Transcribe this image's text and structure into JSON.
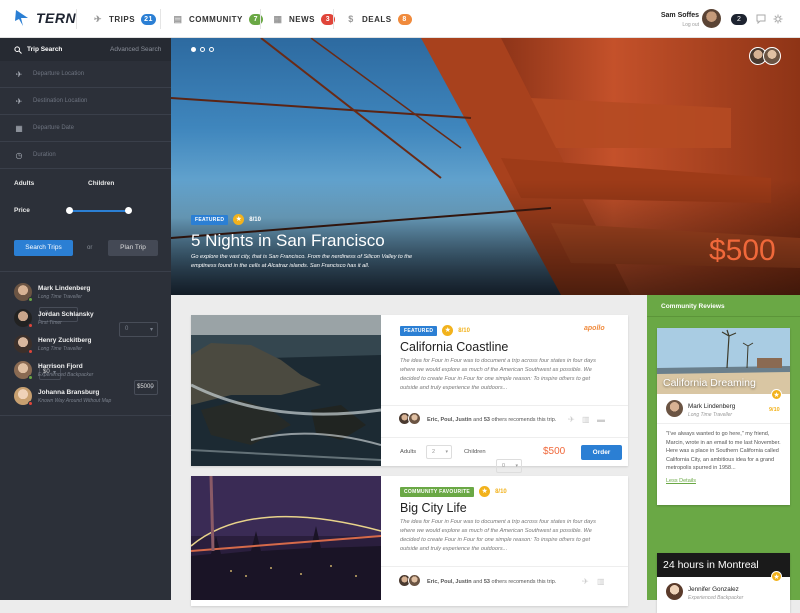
{
  "header": {
    "logo": "TERN",
    "nav": [
      {
        "label": "TRIPS",
        "badge": "21",
        "color": "#2b7fd4",
        "icon": "plane-icon"
      },
      {
        "label": "COMMUNITY",
        "badge": "7",
        "color": "#6aa845",
        "icon": "community-icon"
      },
      {
        "label": "NEWS",
        "badge": "3",
        "color": "#e0453a",
        "icon": "news-icon"
      },
      {
        "label": "DEALS",
        "badge": "8",
        "color": "#f08a3c",
        "icon": "deals-icon"
      }
    ],
    "user": {
      "name": "Sam Soffes",
      "logout": "Log out",
      "count": "2"
    }
  },
  "sidebar": {
    "tabs": {
      "active": "Trip Search",
      "inactive": "Advanced Search"
    },
    "fields": [
      {
        "placeholder": "Departure Location",
        "icon": "plane-takeoff-icon"
      },
      {
        "placeholder": "Destination Location",
        "icon": "plane-landing-icon"
      },
      {
        "placeholder": "Departure Date",
        "icon": "calendar-icon"
      },
      {
        "placeholder": "Duration",
        "icon": "clock-icon"
      }
    ],
    "adults_label": "Adults",
    "adults_value": "0",
    "children_label": "Children",
    "children_value": "0",
    "price_label": "Price",
    "price_min": "$0",
    "price_max": "$5000",
    "price_range": [
      0,
      1
    ],
    "search_button": "Search Trips",
    "or_text": "or",
    "plan_button": "Plan Trip",
    "people": [
      {
        "name": "Mark Lindenberg",
        "role": "Long Time Traveller",
        "status": "#6aa845"
      },
      {
        "name": "Jordan Schlansky",
        "role": "First Timer",
        "status": "#e0453a"
      },
      {
        "name": "Henry Zuckitberg",
        "role": "Long Time Traveller",
        "status": "#e0453a"
      },
      {
        "name": "Harrison Fjord",
        "role": "Experienced Backpacker",
        "status": "#6aa845"
      },
      {
        "name": "Johanna Bransburg",
        "role": "Known Way Around Without Map",
        "status": "#e0453a"
      }
    ]
  },
  "hero": {
    "tag": "FEATURED",
    "rating": "8/10",
    "title": "5 Nights in San Francisco",
    "description": "Go explore the vast city, that is San Francisco. From the nerdiness of Silicon Valley to the emptiness found in the cells at Alcatraz islands. San Francisco has it all.",
    "price": "$500"
  },
  "trips": [
    {
      "tag": "FEATURED",
      "tag_color": "#2b7fd4",
      "rating": "8/10",
      "brand": "apollo",
      "title": "California Coastline",
      "description": "The idea for Four in Four was to document a trip across four states in four days where we would explore as much of the American Southwest as possible. We decided to create Four in Four for one simple reason: To inspire others to get outside and truly experience the outdoors...",
      "recommend_names": "Eric, Poul, Justin",
      "recommend_and": "and",
      "recommend_count": "53",
      "recommend_rest": "others recomends this trip.",
      "adults_label": "Adults",
      "adults_value": "2",
      "children_label": "Children",
      "children_value": "0",
      "price": "$500",
      "order": "Order"
    },
    {
      "tag": "COMMUNITY FAVOURITE",
      "tag_color": "#6aa845",
      "rating": "8/10",
      "title": "Big City Life",
      "description": "The idea for Four in Four was to document a trip across four states in four days where we would explore as much of the American Southwest as possible. We decided to create Four in Four for one simple reason: To inspire others to get outside and truly experience the outdoors...",
      "recommend_names": "Eric, Poul, Justin",
      "recommend_and": "and",
      "recommend_count": "53",
      "recommend_rest": "others recomends this trip."
    }
  ],
  "reviews": {
    "title": "Community Reviews",
    "items": [
      {
        "image_title": "California Dreaming",
        "name": "Mark Lindenberg",
        "role": "Long Time Traveller",
        "score": "9/10",
        "text": "\"I've always wanted to go here,\" my friend, Marcin, wrote in an email to me last November. Here was a place in Southern California called California City, an ambitious idea for a grand metropolis spurred in 1958...",
        "link": "Less Details"
      },
      {
        "image_title": "24 hours in Montreal",
        "name": "Jennifer Gonzalez",
        "role": "Experienced Backpacker"
      }
    ]
  }
}
